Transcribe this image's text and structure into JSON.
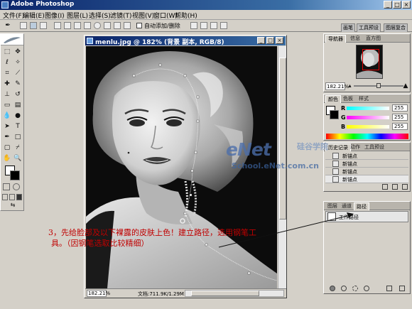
{
  "window": {
    "title": "Adobe Photoshop"
  },
  "menu": [
    "文件(F)",
    "编辑(E)",
    "图像(I)",
    "图层(L)",
    "选择(S)",
    "滤镜(T)",
    "视图(V)",
    "窗口(W)",
    "帮助(H)"
  ],
  "options_bar": {
    "auto_add_delete": "自动添加/删除"
  },
  "palette_well": [
    "画笔",
    "工具预设",
    "图层复合"
  ],
  "document": {
    "title": "menlu.jpg @ 182% (背景 副本, RGB/8)",
    "zoom": "182.21%",
    "doc_size": "文档:711.9K/1.29M"
  },
  "navigator": {
    "tabs": [
      "导航器",
      "信息",
      "直方图"
    ],
    "zoom": "182.21%"
  },
  "color": {
    "tabs": [
      "颜色",
      "色板",
      "样式"
    ],
    "rows": [
      {
        "label": "R",
        "value": "255"
      },
      {
        "label": "G",
        "value": "255"
      },
      {
        "label": "B",
        "value": "255"
      }
    ]
  },
  "history": {
    "tabs": [
      "历史记录",
      "动作",
      "工具预设"
    ],
    "items": [
      "新锚点",
      "新锚点",
      "新锚点",
      "新锚点"
    ]
  },
  "paths": {
    "tabs": [
      "图层",
      "通道",
      "路径"
    ],
    "items": [
      "工作路径"
    ]
  },
  "watermark": {
    "brand": "eNet",
    "brand_cn": "硅谷学院",
    "url": "School.eNet.com.cn"
  },
  "annotation": {
    "line1": "3，先给脸部及以下裸露的皮肤上色！建立路径，选用钢笔工",
    "line2": "具。（因钢笔选取比较精细）"
  }
}
